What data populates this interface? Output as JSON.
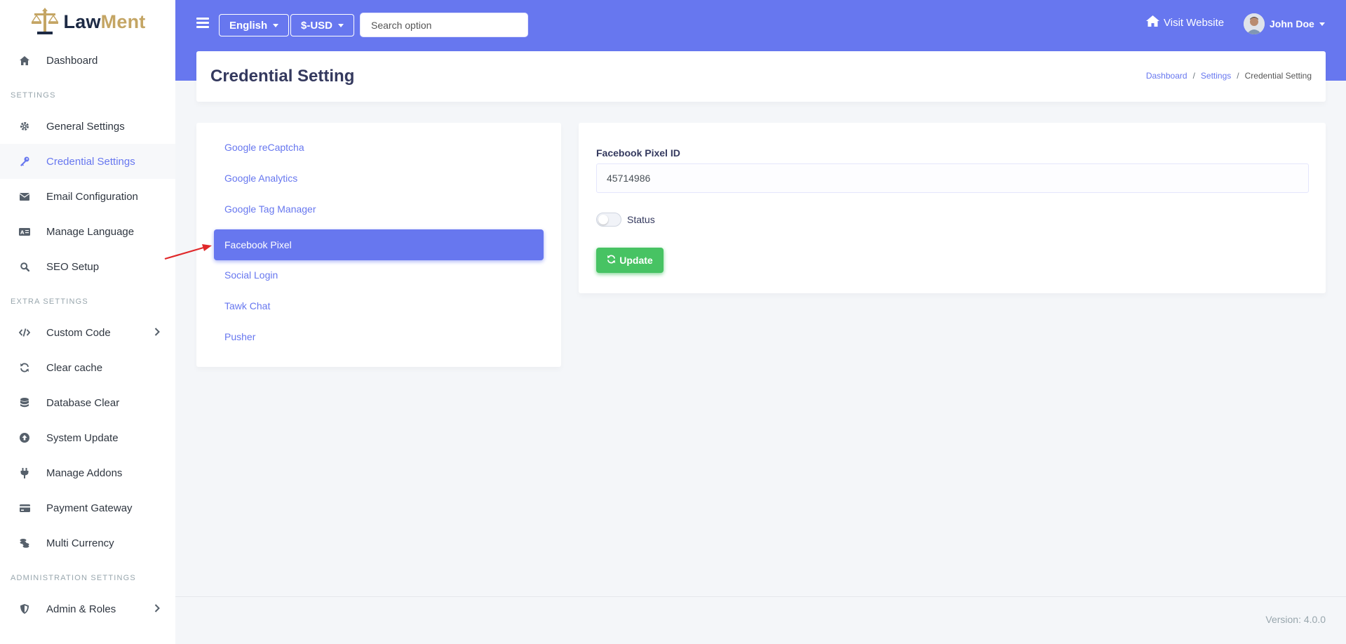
{
  "brand": {
    "name_part1": "Law",
    "name_part2": "Ment",
    "color_dark": "#1d2a44",
    "color_gold": "#c4a564"
  },
  "colors": {
    "primary": "#6777ef",
    "success": "#47c363",
    "sidebar_active_bg": "#f7f8fa"
  },
  "sidebar": {
    "dashboard": "Dashboard",
    "section_settings": "SETTINGS",
    "general_settings": "General Settings",
    "credential_settings": "Credential Settings",
    "email_configuration": "Email Configuration",
    "manage_language": "Manage Language",
    "seo_setup": "SEO Setup",
    "section_extra": "EXTRA SETTINGS",
    "custom_code": "Custom Code",
    "clear_cache": "Clear cache",
    "database_clear": "Database Clear",
    "system_update": "System Update",
    "manage_addons": "Manage Addons",
    "payment_gateway": "Payment Gateway",
    "multi_currency": "Multi Currency",
    "section_admin": "ADMINISTRATION SETTINGS",
    "admin_roles": "Admin & Roles"
  },
  "topbar": {
    "language": "English",
    "currency": "$-USD",
    "search_placeholder": "Search option",
    "visit_website": "Visit Website",
    "user_name": "John Doe"
  },
  "page": {
    "title": "Credential Setting",
    "breadcrumb_dashboard": "Dashboard",
    "breadcrumb_settings": "Settings",
    "breadcrumb_current": "Credential Setting",
    "breadcrumb_sep": "/"
  },
  "tabs": {
    "recaptcha": "Google reCaptcha",
    "analytics": "Google Analytics",
    "tag_manager": "Google Tag Manager",
    "facebook_pixel": "Facebook Pixel",
    "social_login": "Social Login",
    "tawk_chat": "Tawk Chat",
    "pusher": "Pusher"
  },
  "form": {
    "pixel_label": "Facebook Pixel ID",
    "pixel_value": "45714986",
    "status_label": "Status",
    "status_on": false,
    "update_label": "Update"
  },
  "footer": {
    "version": "Version: 4.0.0"
  }
}
